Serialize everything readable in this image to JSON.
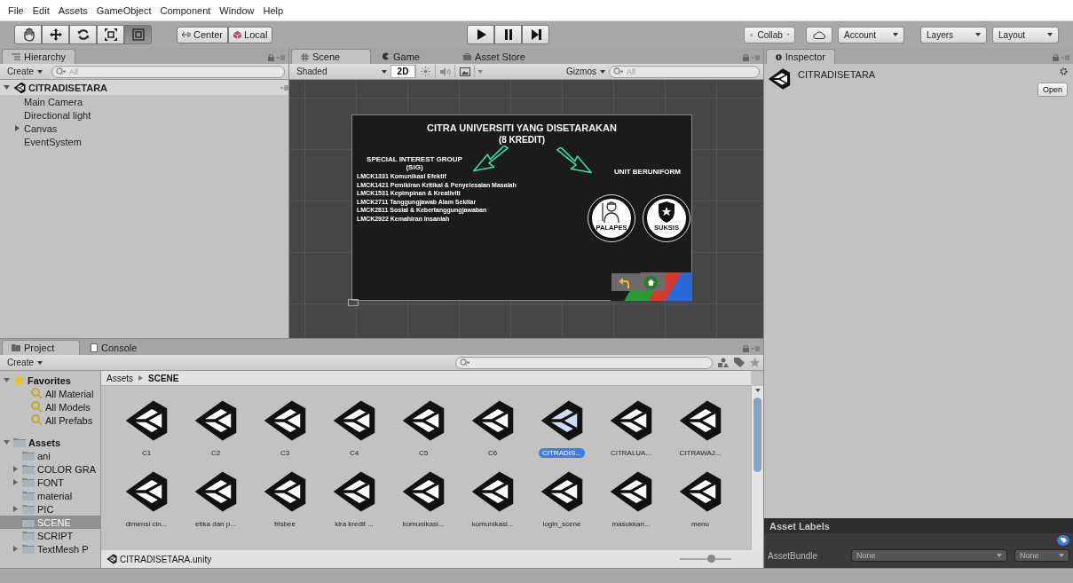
{
  "menu_bar": [
    "File",
    "Edit",
    "Assets",
    "GameObject",
    "Component",
    "Window",
    "Help"
  ],
  "toolbar": {
    "tools": [
      {
        "kind": "hand",
        "selected": false
      },
      {
        "kind": "move",
        "selected": false
      },
      {
        "kind": "rotate",
        "selected": false
      },
      {
        "kind": "scale",
        "selected": false
      },
      {
        "kind": "rect",
        "selected": true
      }
    ],
    "pivot_buttons": [
      {
        "kind": "pivot",
        "label": "Center"
      },
      {
        "kind": "space",
        "label": "Local"
      }
    ],
    "playback": [
      {
        "kind": "play"
      },
      {
        "kind": "pause"
      },
      {
        "kind": "step"
      }
    ],
    "right_buttons": [
      {
        "kind": "collab",
        "label": "Collab"
      },
      {
        "kind": "cloud"
      },
      {
        "kind": "account",
        "label": "Account"
      },
      {
        "kind": "layers",
        "label": "Layers"
      },
      {
        "kind": "layout",
        "label": "Layout"
      }
    ]
  },
  "hierarchy": {
    "tab": "Hierarchy",
    "create": "Create",
    "search_placeholder": "All",
    "scene": {
      "name": "CITRADISETARA",
      "expanded": true,
      "children": [
        {
          "name": "Main Camera"
        },
        {
          "name": "Directional light"
        },
        {
          "name": "Canvas",
          "expanded": false
        },
        {
          "name": "EventSystem"
        }
      ]
    }
  },
  "scene_view": {
    "tabs": [
      {
        "kind": "scene",
        "label": "Scene",
        "selected": true
      },
      {
        "kind": "game",
        "label": "Game",
        "selected": false
      },
      {
        "kind": "store",
        "label": "Asset Store",
        "selected": false
      }
    ],
    "shading": "Shaded",
    "mode_2d": {
      "label": "2D",
      "on": true
    },
    "gizmos": "Gizmos",
    "search_placeholder": "All",
    "canvas": {
      "title": "CITRA UNIVERSITI YANG DISETARAKAN",
      "subtitle": "(8 KREDIT)",
      "left_heading": "SPECIAL INTEREST GROUP",
      "left_subheading": "(SIG)",
      "courses": [
        "LMCK1331 Komunikasi Efektif",
        "LMCK1421 Pemikiran Kritikal & Penyelesaian Masalah",
        "LMCK1531 Kepimpinan & Kreativiti",
        "LMCK2711 Tanggungjawab Alam Sekitar",
        "LMCK2811 Sosial & Kebertanggungjawaban",
        "LMCK2922 Kemahiran Insaniah"
      ],
      "right_heading": "UNIT BERUNIFORM",
      "badges": [
        {
          "kind": "soldier",
          "label": "PALAPES"
        },
        {
          "kind": "shield",
          "label": "SUKSIS"
        }
      ]
    }
  },
  "inspector": {
    "tab": "Inspector",
    "asset_name": "CITRADISETARA",
    "open_button": "Open",
    "labels_title": "Asset Labels",
    "asset_bundle": {
      "label": "AssetBundle",
      "name": "None",
      "variant": "None"
    }
  },
  "project": {
    "tabs": [
      {
        "label": "Project",
        "selected": true
      },
      {
        "label": "Console",
        "selected": false
      }
    ],
    "create": "Create",
    "favorites": {
      "label": "Favorites",
      "expanded": true,
      "children": [
        {
          "label": "All Material",
          "selected": false
        },
        {
          "label": "All Models",
          "selected": false
        },
        {
          "label": "All Prefabs",
          "selected": false
        }
      ]
    },
    "assets": {
      "label": "Assets",
      "expanded": true,
      "children": [
        {
          "label": "ani",
          "selected": false
        },
        {
          "label": "COLOR GRA",
          "expanded": false,
          "selected": false
        },
        {
          "label": "FONT",
          "expanded": false,
          "selected": false
        },
        {
          "label": "material",
          "selected": false
        },
        {
          "label": "PIC",
          "expanded": false,
          "selected": false
        },
        {
          "label": "SCENE",
          "selected": true
        },
        {
          "label": "SCRIPT",
          "selected": false
        },
        {
          "label": "TextMesh P",
          "expanded": false,
          "selected": false
        }
      ]
    },
    "breadcrumb": [
      "Assets",
      "SCENE"
    ],
    "items": [
      {
        "label": "C1",
        "selected": false
      },
      {
        "label": "C2",
        "selected": false
      },
      {
        "label": "C3",
        "selected": false
      },
      {
        "label": "C4",
        "selected": false
      },
      {
        "label": "C5",
        "selected": false
      },
      {
        "label": "C6",
        "selected": false
      },
      {
        "label": "CITRADIS...",
        "selected": true
      },
      {
        "label": "CITRALUA...",
        "selected": false
      },
      {
        "label": "CITRAWAJ...",
        "selected": false
      },
      {
        "label": "dimensi cin...",
        "selected": false
      },
      {
        "label": "etika dan p...",
        "selected": false
      },
      {
        "label": "frisbee",
        "selected": false
      },
      {
        "label": "kira kredit ...",
        "selected": false
      },
      {
        "label": "komunikasi...",
        "selected": false
      },
      {
        "label": "komunikasi...",
        "selected": false
      },
      {
        "label": "login_scene",
        "selected": false
      },
      {
        "label": "masukkan...",
        "selected": false
      },
      {
        "label": "menu",
        "selected": false
      }
    ],
    "selected_path": "CITRADISETARA.unity",
    "icon_size": {
      "level": 0.6
    }
  }
}
